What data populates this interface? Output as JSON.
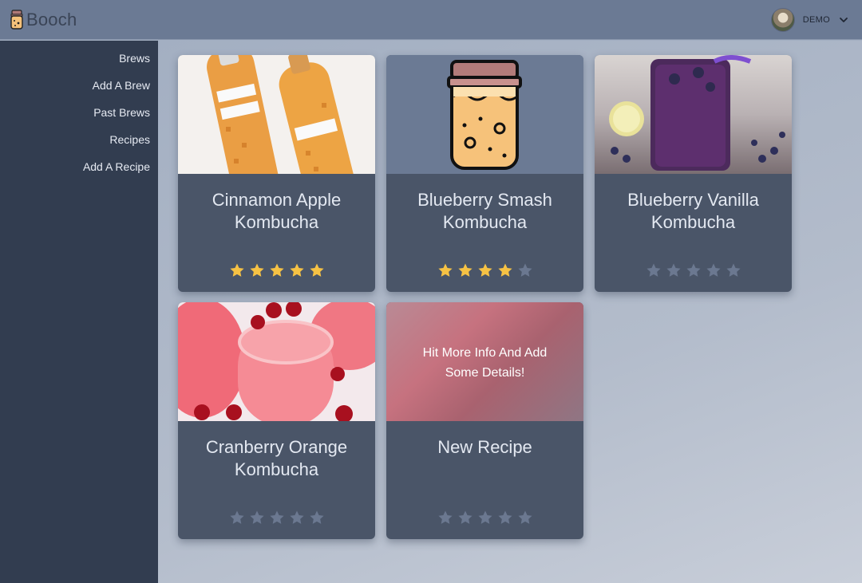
{
  "app": {
    "title": "Booch"
  },
  "user": {
    "name": "DEMO"
  },
  "sidebar": {
    "items": [
      {
        "label": "Brews"
      },
      {
        "label": "Add A Brew"
      },
      {
        "label": "Past Brews"
      },
      {
        "label": "Recipes"
      },
      {
        "label": "Add A Recipe"
      }
    ]
  },
  "recipes": [
    {
      "title_line1": "Cinnamon Apple",
      "title_line2": "Kombucha",
      "rating": 5,
      "max_rating": 5
    },
    {
      "title_line1": "Blueberry Smash",
      "title_line2": "Kombucha",
      "rating": 4,
      "max_rating": 5
    },
    {
      "title_line1": "Blueberry Vanilla",
      "title_line2": "Kombucha",
      "rating": 0,
      "max_rating": 5
    },
    {
      "title_line1": "Cranberry Orange",
      "title_line2": "Kombucha",
      "rating": 0,
      "max_rating": 5
    },
    {
      "title_line1": "New Recipe",
      "title_line2": "",
      "rating": 0,
      "max_rating": 5,
      "overlay_line1": "Hit More Info And Add",
      "overlay_line2": "Some Details!"
    }
  ],
  "colors": {
    "header": "#6b7a94",
    "sidebar": "#323d50",
    "card": "#4a5568",
    "star_on": "#f6c244",
    "star_off": "#6b7890"
  }
}
